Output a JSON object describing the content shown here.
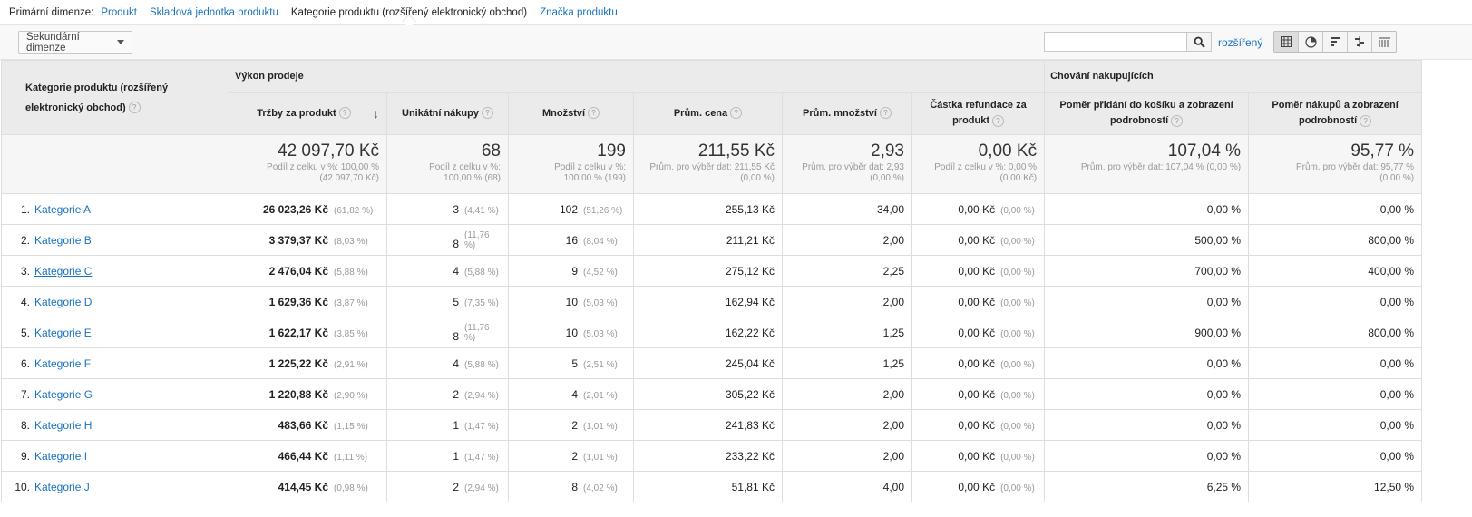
{
  "primary": {
    "label": "Primární dimenze:",
    "options": [
      "Produkt",
      "Skladová jednotka produktu",
      "Kategorie produktu (rozšířený elektronický obchod)",
      "Značka produktu"
    ],
    "active_index": 2
  },
  "toolbar": {
    "secondary_label": "Sekundární dimenze",
    "search_value": "",
    "advanced_label": "rozšířený"
  },
  "groups": {
    "sales": "Výkon prodeje",
    "behavior": "Chování nakupujících"
  },
  "columns": {
    "dimension": "Kategorie produktu (rozšířený elektronický obchod)",
    "revenue": "Tržby za produkt",
    "unique": "Unikátní nákupy",
    "quantity": "Množství",
    "avg_price": "Prům. cena",
    "avg_qty": "Prům. množství",
    "refund": "Částka refundace za produkt",
    "cart_ratio": "Poměr přidání do košíku a zobrazení podrobností",
    "buy_ratio": "Poměr nákupů a zobrazení podrobností"
  },
  "totals": {
    "revenue": {
      "value": "42 097,70 Kč",
      "sub1": "Podíl z celku v %: 100,00 %",
      "sub2": "(42 097,70 Kč)"
    },
    "unique": {
      "value": "68",
      "sub1": "Podíl z celku v %:",
      "sub2": "100,00 % (68)"
    },
    "quantity": {
      "value": "199",
      "sub1": "Podíl z celku v %:",
      "sub2": "100,00 % (199)"
    },
    "avg_price": {
      "value": "211,55 Kč",
      "sub1": "Prům. pro výběr dat: 211,55 Kč",
      "sub2": "(0,00 %)"
    },
    "avg_qty": {
      "value": "2,93",
      "sub1": "Prům. pro výběr dat: 2,93",
      "sub2": "(0,00 %)"
    },
    "refund": {
      "value": "0,00 Kč",
      "sub1": "Podíl z celku v %: 0,00 %",
      "sub2": "(0,00 Kč)"
    },
    "cart_ratio": {
      "value": "107,04 %",
      "sub1": "Prům. pro výběr dat: 107,04 % (0,00 %)",
      "sub2": ""
    },
    "buy_ratio": {
      "value": "95,77 %",
      "sub1": "Prům. pro výběr dat: 95,77 %",
      "sub2": "(0,00 %)"
    }
  },
  "rows": [
    {
      "idx": "1.",
      "name": "Kategorie A",
      "rev": "26 023,26 Kč",
      "rev_p": "(61,82 %)",
      "uni": "3",
      "uni_p": "(4,41 %)",
      "qty": "102",
      "qty_p": "(51,26 %)",
      "price": "255,13 Kč",
      "avgq": "34,00",
      "ref": "0,00 Kč",
      "ref_p": "(0,00 %)",
      "cart": "0,00 %",
      "buy": "0,00 %"
    },
    {
      "idx": "2.",
      "name": "Kategorie B",
      "rev": "3 379,37 Kč",
      "rev_p": "(8,03 %)",
      "uni": "8",
      "uni_p": "(11,76 %)",
      "qty": "16",
      "qty_p": "(8,04 %)",
      "price": "211,21 Kč",
      "avgq": "2,00",
      "ref": "0,00 Kč",
      "ref_p": "(0,00 %)",
      "cart": "500,00 %",
      "buy": "800,00 %"
    },
    {
      "idx": "3.",
      "name": "Kategorie C",
      "rev": "2 476,04 Kč",
      "rev_p": "(5,88 %)",
      "uni": "4",
      "uni_p": "(5,88 %)",
      "qty": "9",
      "qty_p": "(4,52 %)",
      "price": "275,12 Kč",
      "avgq": "2,25",
      "ref": "0,00 Kč",
      "ref_p": "(0,00 %)",
      "cart": "700,00 %",
      "buy": "400,00 %"
    },
    {
      "idx": "4.",
      "name": "Kategorie D",
      "rev": "1 629,36 Kč",
      "rev_p": "(3,87 %)",
      "uni": "5",
      "uni_p": "(7,35 %)",
      "qty": "10",
      "qty_p": "(5,03 %)",
      "price": "162,94 Kč",
      "avgq": "2,00",
      "ref": "0,00 Kč",
      "ref_p": "(0,00 %)",
      "cart": "0,00 %",
      "buy": "0,00 %"
    },
    {
      "idx": "5.",
      "name": "Kategorie E",
      "rev": "1 622,17 Kč",
      "rev_p": "(3,85 %)",
      "uni": "8",
      "uni_p": "(11,76 %)",
      "qty": "10",
      "qty_p": "(5,03 %)",
      "price": "162,22 Kč",
      "avgq": "1,25",
      "ref": "0,00 Kč",
      "ref_p": "(0,00 %)",
      "cart": "900,00 %",
      "buy": "800,00 %"
    },
    {
      "idx": "6.",
      "name": "Kategorie F",
      "rev": "1 225,22 Kč",
      "rev_p": "(2,91 %)",
      "uni": "4",
      "uni_p": "(5,88 %)",
      "qty": "5",
      "qty_p": "(2,51 %)",
      "price": "245,04 Kč",
      "avgq": "1,25",
      "ref": "0,00 Kč",
      "ref_p": "(0,00 %)",
      "cart": "0,00 %",
      "buy": "0,00 %"
    },
    {
      "idx": "7.",
      "name": "Kategorie G",
      "rev": "1 220,88 Kč",
      "rev_p": "(2,90 %)",
      "uni": "2",
      "uni_p": "(2,94 %)",
      "qty": "4",
      "qty_p": "(2,01 %)",
      "price": "305,22 Kč",
      "avgq": "2,00",
      "ref": "0,00 Kč",
      "ref_p": "(0,00 %)",
      "cart": "0,00 %",
      "buy": "0,00 %"
    },
    {
      "idx": "8.",
      "name": "Kategorie H",
      "rev": "483,66 Kč",
      "rev_p": "(1,15 %)",
      "uni": "1",
      "uni_p": "(1,47 %)",
      "qty": "2",
      "qty_p": "(1,01 %)",
      "price": "241,83 Kč",
      "avgq": "2,00",
      "ref": "0,00 Kč",
      "ref_p": "(0,00 %)",
      "cart": "0,00 %",
      "buy": "0,00 %"
    },
    {
      "idx": "9.",
      "name": "Kategorie I",
      "rev": "466,44 Kč",
      "rev_p": "(1,11 %)",
      "uni": "1",
      "uni_p": "(1,47 %)",
      "qty": "2",
      "qty_p": "(1,01 %)",
      "price": "233,22 Kč",
      "avgq": "2,00",
      "ref": "0,00 Kč",
      "ref_p": "(0,00 %)",
      "cart": "0,00 %",
      "buy": "0,00 %"
    },
    {
      "idx": "10.",
      "name": "Kategorie J",
      "rev": "414,45 Kč",
      "rev_p": "(0,98 %)",
      "uni": "2",
      "uni_p": "(2,94 %)",
      "qty": "8",
      "qty_p": "(4,02 %)",
      "price": "51,81 Kč",
      "avgq": "4,00",
      "ref": "0,00 Kč",
      "ref_p": "(0,00 %)",
      "cart": "6,25 %",
      "buy": "12,50 %"
    }
  ],
  "hovered_row_index": 2,
  "colors": {
    "link": "#1a73bf",
    "header_bg": "#ebebeb",
    "muted": "#999999"
  }
}
